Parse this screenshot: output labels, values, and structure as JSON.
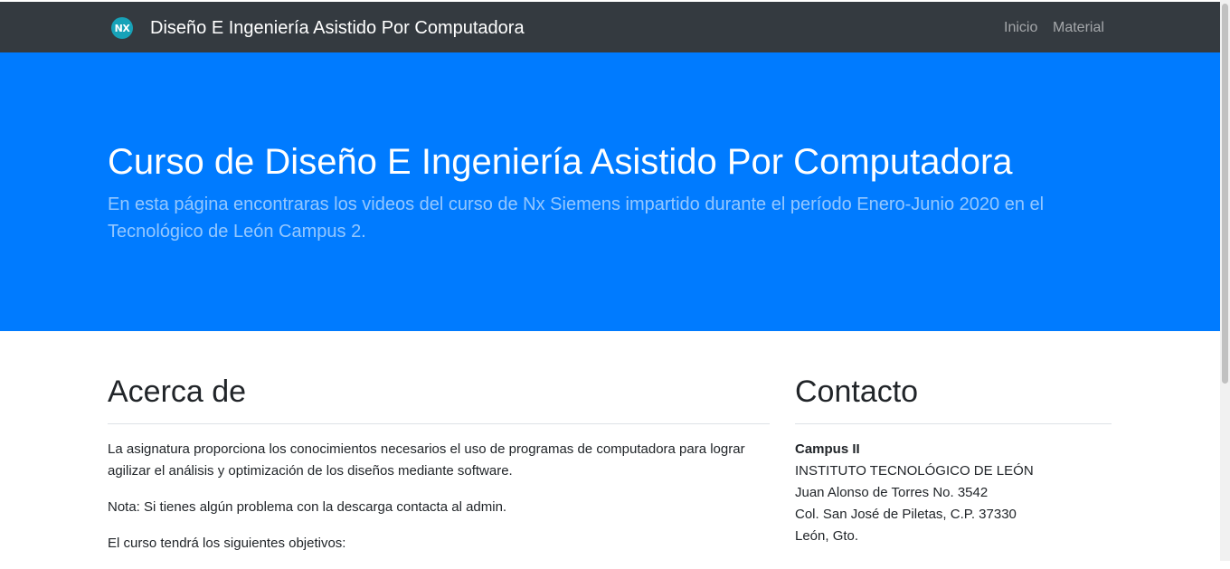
{
  "navbar": {
    "logo_text": "NX",
    "brand": "Diseño E Ingeniería Asistido Por Computadora",
    "links": [
      {
        "label": "Inicio"
      },
      {
        "label": "Material"
      }
    ]
  },
  "hero": {
    "title": "Curso de Diseño E Ingeniería Asistido Por Computadora",
    "lead": "En esta página encontraras los videos del curso de Nx Siemens impartido durante el período Enero-Junio 2020 en el Tecnológico de León Campus 2."
  },
  "about": {
    "title": "Acerca de",
    "paragraphs": [
      "La asignatura proporciona los conocimientos necesarios el uso de programas de computadora para lograr agilizar el análisis y optimización de los diseños mediante software.",
      "Nota: Si tienes algún problema con la descarga contacta al admin.",
      "El curso tendrá los siguientes objetivos:"
    ]
  },
  "contact": {
    "title": "Contacto",
    "campus": "Campus II",
    "lines": [
      "INSTITUTO TECNOLÓGICO DE LEÓN",
      "Juan Alonso de Torres No. 3542",
      "Col. San José de Piletas, C.P. 37330",
      "León, Gto."
    ]
  },
  "colors": {
    "navbar_bg": "#343a40",
    "hero_bg": "#007bff",
    "logo_bg": "#17a2b8"
  }
}
